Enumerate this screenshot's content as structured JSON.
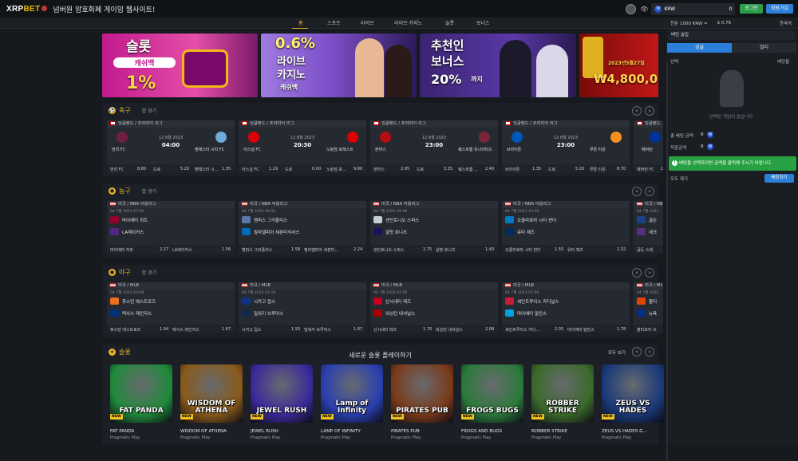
{
  "header": {
    "logo_main": "XRP",
    "logo_accent": "BET",
    "slogan": "넘버원 암호화폐 게이밍 웹사이트!",
    "currency": "KRW",
    "balance": "0",
    "login": "로그인",
    "signup": "회원가입"
  },
  "nav": [
    "홈",
    "스포츠",
    "라이브",
    "라이브 카지노",
    "슬롯",
    "보너스"
  ],
  "sub": {
    "bal": "잔돈 1000 KRW =",
    "usd": "$ 0.76",
    "lang": "한국어"
  },
  "banners": [
    {
      "line1": "슬롯",
      "line2": "캐쉬백",
      "line3": "1%",
      "bg": "#b9198f"
    },
    {
      "line1": "0.6%",
      "line2": "라이브",
      "line3": "카지노",
      "line4": "캐쉬백",
      "bg": "#8a5fd4"
    },
    {
      "line1": "추천인",
      "line2": "보너스",
      "line3": "20%",
      "line4": "까지",
      "bg": "#4a2d8c"
    },
    {
      "line1": "₩4,800,0",
      "line2": "2023년5월27일",
      "bg": "#a01414"
    }
  ],
  "sections": {
    "soccer": {
      "title": "축구",
      "sub": "합 경기"
    },
    "basketball": {
      "title": "농구",
      "sub": "합 경기"
    },
    "baseball": {
      "title": "야구",
      "sub": "합 경기"
    },
    "slots": {
      "title": "슬롯",
      "center": "새로운 슬롯 플레이하기",
      "more": "모두 보기"
    }
  },
  "soccer": [
    {
      "league": "잉글랜드 / 프리미어 리그",
      "date": "12 8월 2023",
      "time": "04:00",
      "home": "번리 FC",
      "away": "맨체스터 시티 FC",
      "o1": "번리 FC",
      "v1": "8.80",
      "ox": "드로",
      "vx": "5.20",
      "o2": "맨체스터 시...",
      "v2": "1.35",
      "c1": "#6d1f3f",
      "c2": "#6cabdd"
    },
    {
      "league": "잉글랜드 / 프리미어 리그",
      "date": "12 8월 2023",
      "time": "20:30",
      "home": "아스널 FC",
      "away": "노팅엄 포레스트",
      "o1": "아스널 FC",
      "v1": "1.29",
      "ox": "드로",
      "vx": "6.00",
      "o2": "노팅엄 포...",
      "v2": "9.80",
      "c1": "#db0007",
      "c2": "#dd0000"
    },
    {
      "league": "잉글랜드 / 프리미어 리그",
      "date": "12 8월 2023",
      "time": "23:00",
      "home": "본머스",
      "away": "웨스트햄 유나이티드",
      "o1": "본머스",
      "v1": "2.95",
      "ox": "드로",
      "vx": "3.35",
      "o2": "웨스트햄 ...",
      "v2": "2.40",
      "c1": "#b50e12",
      "c2": "#7a263a"
    },
    {
      "league": "잉글랜드 / 프리미어 리그",
      "date": "12 8월 2023",
      "time": "23:00",
      "home": "브라이튼",
      "away": "루튼 타운",
      "o1": "브라이튼",
      "v1": "1.35",
      "ox": "드로",
      "vx": "5.20",
      "o2": "루튼 타운",
      "v2": "8.70",
      "c1": "#0057b8",
      "c2": "#f78f1e"
    },
    {
      "league": "잉글랜드",
      "home": "에버턴",
      "o1": "에버턴 FC",
      "v1": "1.",
      "c1": "#003399"
    }
  ],
  "basketball": [
    {
      "league": "미국 / NBA 어를리그",
      "date": "04 7월 2023 07:00",
      "home": "마이애미 히트",
      "away": "LA레이커스",
      "o1": "마이애미 히트",
      "v1": "2.27",
      "o2": "LA레이커스",
      "v2": "1.56",
      "c1": "#98002e",
      "c2": "#552583"
    },
    {
      "league": "미국 / NBA 어를리그",
      "date": "04 7월 2023 08:00",
      "home": "멤피스 그리즐리스",
      "away": "필라델피아 세븐티식서스",
      "o1": "멤피스 그리즐리스",
      "v1": "1.58",
      "o2": "필라델피아 세븐티...",
      "v2": "2.24",
      "c1": "#5d76a9",
      "c2": "#006bb6"
    },
    {
      "league": "미국 / NBA 어를리그",
      "date": "04 7월 2023 09:00",
      "home": "샌안토니오 스퍼스",
      "away": "샬럿 호니츠",
      "o1": "샌안토니오 스퍼스",
      "v1": "2.75",
      "o2": "샬럿 호니츠",
      "v2": "1.40",
      "c1": "#c4ced4",
      "c2": "#1d1160"
    },
    {
      "league": "미국 / NBA 어를리그",
      "date": "04 7월 2023 10:00",
      "home": "오클라호마 시티 썬더",
      "away": "유타 재즈",
      "o1": "오클라호마 시티 썬더",
      "v1": "1.55",
      "o2": "유타 재즈",
      "v2": "2.32",
      "c1": "#007ac1",
      "c2": "#002b5c"
    },
    {
      "league": "미국 / NB",
      "date": "04 7월 2023",
      "home": "골든",
      "away": "새크",
      "o1": "골든 스테",
      "v1": "",
      "c1": "#1d428a",
      "c2": "#5a2d81"
    }
  ],
  "baseball": [
    {
      "league": "미국 / MLB",
      "date": "04 7월 2023 03:08",
      "home": "휴스턴 애스트로즈",
      "away": "텍사스 레인저스",
      "o1": "휴스턴 애스트로즈",
      "v1": "1.94",
      "o2": "텍사스 레인저스",
      "v2": "1.87",
      "c1": "#eb6e1f",
      "c2": "#003278"
    },
    {
      "league": "미국 / MLB",
      "date": "04 7월 2023 03:10",
      "home": "시카고 컵스",
      "away": "밀워키 브루어스",
      "o1": "시카고 컵스",
      "v1": "1.93",
      "o2": "밀워키 브루어스",
      "v2": "1.87",
      "c1": "#0e3386",
      "c2": "#12284b"
    },
    {
      "league": "미국 / MLB",
      "date": "04 7월 2023 07:05",
      "home": "신시내티 레즈",
      "away": "워싱턴 내셔널스",
      "o1": "신시내티 레즈",
      "v1": "1.76",
      "o2": "워싱턴 내셔널스",
      "v2": "2.08",
      "c1": "#c6011f",
      "c2": "#ab0003"
    },
    {
      "league": "미국 / MLB",
      "date": "04 7월 2023 07:40",
      "home": "세인트루이스 카디널스",
      "away": "마이애미 말린스",
      "o1": "세인트루이스 카디...",
      "v1": "2.05",
      "o2": "마이애미 말린스",
      "v2": "1.78",
      "c1": "#c41e3a",
      "c2": "#00a3e0"
    },
    {
      "league": "미국 / MLB",
      "date": "04 7월 2023",
      "home": "볼티",
      "away": "뉴욕",
      "o1": "볼티모어 오",
      "v1": "",
      "c1": "#df4601",
      "c2": "#003087"
    }
  ],
  "games": [
    {
      "name": "FAT PANDA",
      "art": "FAT PANDA",
      "provider": "Pragmatic Play",
      "bg": "#1f8a3a"
    },
    {
      "name": "WISDOM OF ATHENA",
      "art": "WISDOM OF ATHENA",
      "provider": "Pragmatic Play",
      "bg": "#8a5a1a"
    },
    {
      "name": "JEWEL RUSH",
      "art": "JEWEL RUSH",
      "provider": "Pragmatic Play",
      "bg": "#3b2a9a"
    },
    {
      "name": "LAMP OF INFINITY",
      "art": "Lamp of Infinity",
      "provider": "Pragmatic Play",
      "bg": "#2a3fb0"
    },
    {
      "name": "PIRATES PUB",
      "art": "PIRATES PUB",
      "provider": "Pragmatic Play",
      "bg": "#7a3a1a"
    },
    {
      "name": "FROGS AND BUGS",
      "art": "FROGS BUGS",
      "provider": "Pragmatic Play",
      "bg": "#2a7a3a"
    },
    {
      "name": "ROBBER STRIKE",
      "art": "ROBBER STRIKE",
      "provider": "Pragmatic Play",
      "bg": "#3a6a2a"
    },
    {
      "name": "ZEUS VS HADES G...",
      "art": "ZEUS VS HADES",
      "provider": "Pragmatic Play",
      "bg": "#1a3a7a"
    }
  ],
  "betslip": {
    "title": "배팅 슬립",
    "tab1": "싱글",
    "tab2": "멀티",
    "sel": "선택",
    "odds": "배당율",
    "empty": "선택된 게임이 없습니다.",
    "total": "총 베팅 금액",
    "win": "적중금액",
    "zero": "0",
    "notice": "배팅을 선택하려면 금액을 클릭해 주시기 바랍니다.",
    "clear": "모두 제거",
    "place": "배팅하기"
  }
}
